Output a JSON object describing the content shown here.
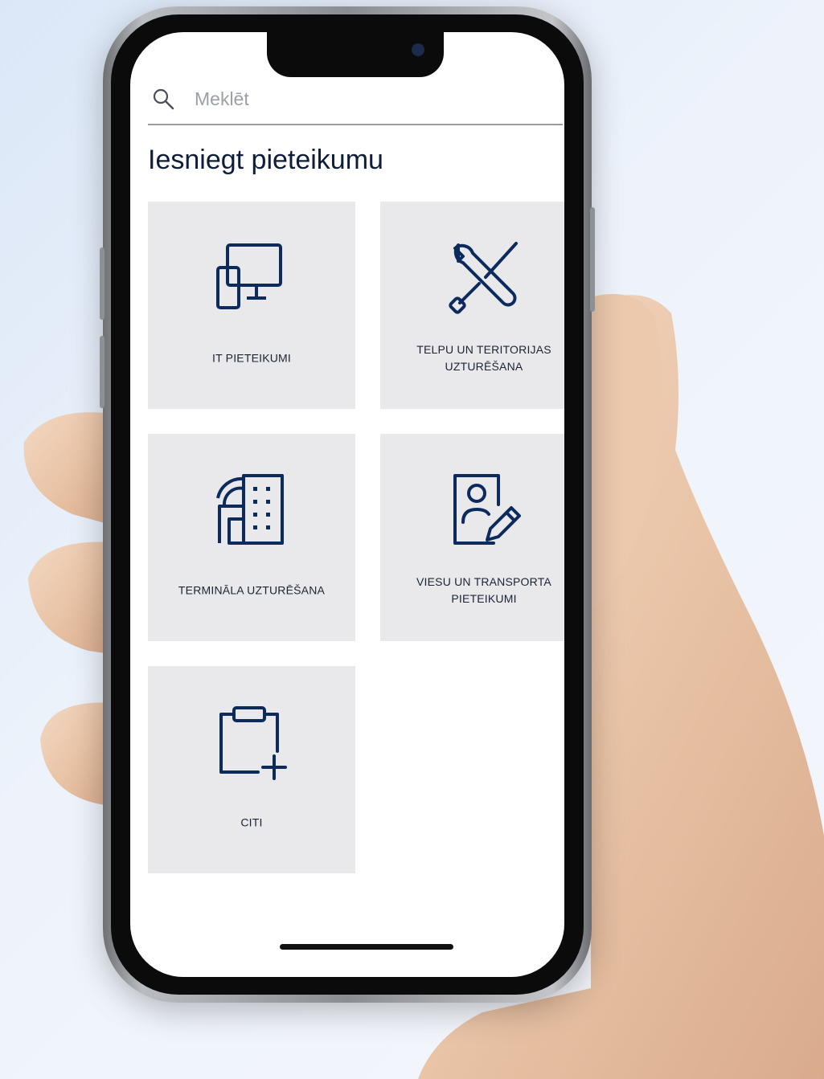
{
  "search": {
    "placeholder": "Meklēt"
  },
  "page": {
    "title": "Iesniegt pieteikumu"
  },
  "tiles": [
    {
      "label": "IT PIETEIKUMI",
      "icon": "devices-icon"
    },
    {
      "label": "TELPU UN TERITORIJAS UZTURĒŠANA",
      "icon": "tools-icon"
    },
    {
      "label": "TERMINĀLA UZTURĒŠANA",
      "icon": "building-icon"
    },
    {
      "label": "VIESU UN TRANSPORTA PIETEIKUMI",
      "icon": "person-edit-icon"
    },
    {
      "label": "CITI",
      "icon": "clipboard-add-icon"
    }
  ],
  "colors": {
    "icon": "#0d2a5c",
    "tile": "#e9e9ec",
    "title": "#0f1d3a"
  }
}
